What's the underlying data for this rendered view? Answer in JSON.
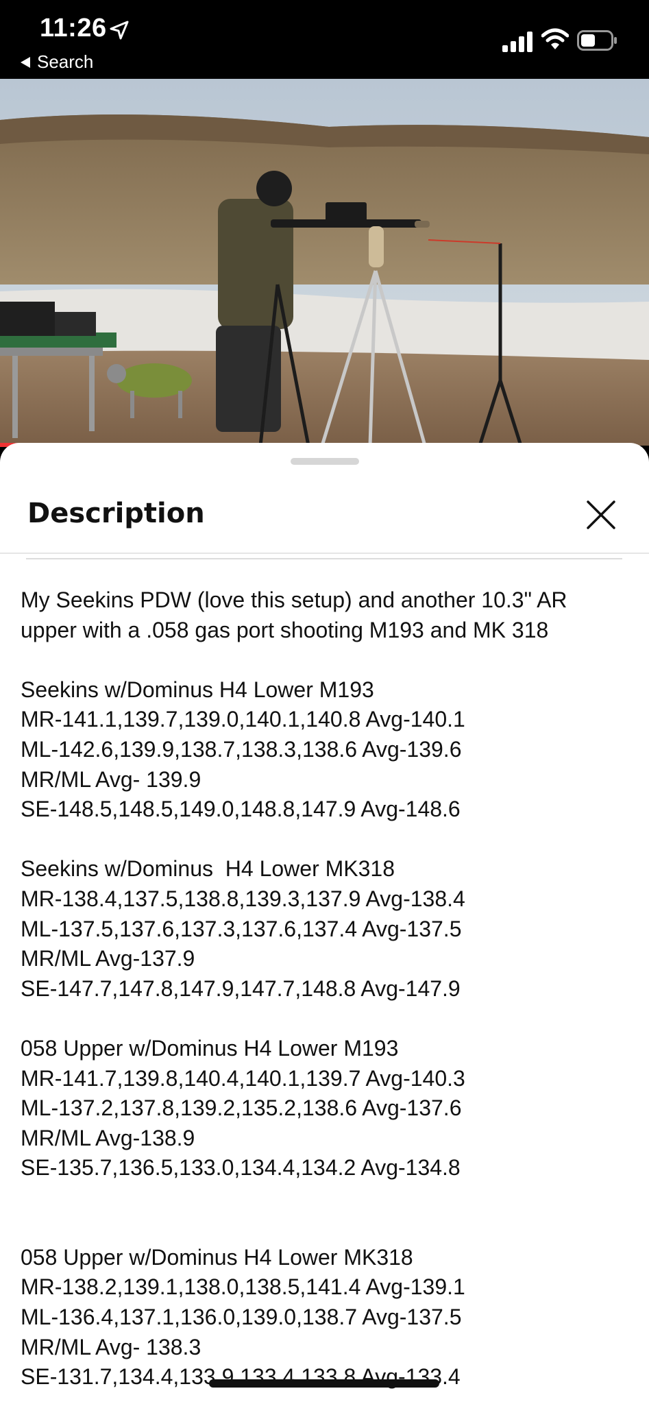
{
  "status_bar": {
    "time": "11:26",
    "back_label": "Search",
    "icons": [
      "location-arrow-icon",
      "cellular-signal-icon",
      "wifi-icon",
      "battery-icon"
    ]
  },
  "video": {
    "progress_color": "#e33333"
  },
  "sheet": {
    "title": "Description",
    "close_icon": "close-icon",
    "intro_lines": [
      "My Seekins PDW (love this setup) and another 10.3\" AR",
      "upper with a .058 gas port shooting M193 and MK 318"
    ],
    "groups": [
      {
        "heading": "Seekins w/Dominus H4 Lower M193",
        "lines": [
          "MR-141.1,139.7,139.0,140.1,140.8 Avg-140.1",
          "ML-142.6,139.9,138.7,138.3,138.6 Avg-139.6",
          "MR/ML Avg- 139.9",
          "SE-148.5,148.5,149.0,148.8,147.9 Avg-148.6"
        ]
      },
      {
        "heading": "Seekins w/Dominus  H4 Lower MK318",
        "lines": [
          "MR-138.4,137.5,138.8,139.3,137.9 Avg-138.4",
          "ML-137.5,137.6,137.3,137.6,137.4 Avg-137.5",
          "MR/ML Avg-137.9",
          "SE-147.7,147.8,147.9,147.7,148.8 Avg-147.9"
        ]
      },
      {
        "heading": "058 Upper w/Dominus H4 Lower M193",
        "lines": [
          "MR-141.7,139.8,140.4,140.1,139.7 Avg-140.3",
          "ML-137.2,137.8,139.2,135.2,138.6 Avg-137.6",
          "MR/ML Avg-138.9",
          "SE-135.7,136.5,133.0,134.4,134.2 Avg-134.8"
        ]
      },
      {
        "heading": "058 Upper w/Dominus H4 Lower MK318",
        "lines": [
          "MR-138.2,139.1,138.0,138.5,141.4 Avg-139.1",
          "ML-136.4,137.1,136.0,139.0,138.7 Avg-137.5",
          "MR/ML Avg- 138.3",
          "SE-131.7,134.4,133.9,133.4,133.8 Avg-133.4"
        ]
      }
    ]
  }
}
